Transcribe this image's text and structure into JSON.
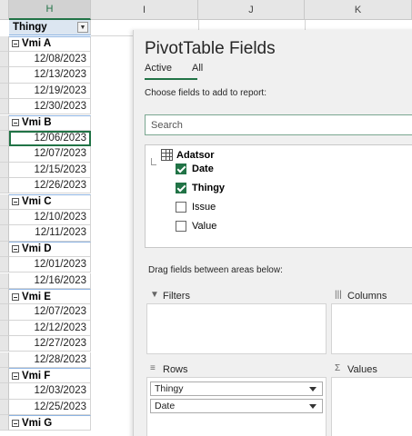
{
  "columns": [
    "H",
    "I",
    "J",
    "K"
  ],
  "selected_column": "H",
  "pivot_header": "Thingy",
  "filter_icon": "filter-dropdown-icon",
  "rows": [
    {
      "type": "group",
      "label": "Vmi A"
    },
    {
      "type": "date",
      "label": "12/08/2023"
    },
    {
      "type": "date",
      "label": "12/13/2023"
    },
    {
      "type": "date",
      "label": "12/19/2023"
    },
    {
      "type": "date",
      "label": "12/30/2023"
    },
    {
      "type": "group",
      "label": "Vmi B"
    },
    {
      "type": "date",
      "label": "12/06/2023",
      "selected": true
    },
    {
      "type": "date",
      "label": "12/07/2023"
    },
    {
      "type": "date",
      "label": "12/15/2023"
    },
    {
      "type": "date",
      "label": "12/26/2023"
    },
    {
      "type": "group",
      "label": "Vmi C"
    },
    {
      "type": "date",
      "label": "12/10/2023"
    },
    {
      "type": "date",
      "label": "12/11/2023"
    },
    {
      "type": "group",
      "label": "Vmi D"
    },
    {
      "type": "date",
      "label": "12/01/2023"
    },
    {
      "type": "date",
      "label": "12/16/2023"
    },
    {
      "type": "group",
      "label": "Vmi E"
    },
    {
      "type": "date",
      "label": "12/07/2023"
    },
    {
      "type": "date",
      "label": "12/12/2023"
    },
    {
      "type": "date",
      "label": "12/27/2023"
    },
    {
      "type": "date",
      "label": "12/28/2023"
    },
    {
      "type": "group",
      "label": "Vmi F"
    },
    {
      "type": "date",
      "label": "12/03/2023"
    },
    {
      "type": "date",
      "label": "12/25/2023"
    },
    {
      "type": "group",
      "label": "Vmi G"
    }
  ],
  "pane": {
    "title": "PivotTable Fields",
    "tabs": {
      "active": "Active",
      "all": "All"
    },
    "choose_text": "Choose fields to add to report:",
    "search_placeholder": "Search",
    "table_name": "Adatsor",
    "fields": [
      {
        "name": "Date",
        "checked": true
      },
      {
        "name": "Thingy",
        "checked": true
      },
      {
        "name": "Issue",
        "checked": false
      },
      {
        "name": "Value",
        "checked": false
      }
    ],
    "drag_text": "Drag fields between areas below:",
    "areas": {
      "filters": "Filters",
      "columns": "Columns",
      "rows": "Rows",
      "values": "Values"
    },
    "row_fields": [
      "Thingy",
      "Date"
    ]
  },
  "colors": {
    "accent": "#217346",
    "header_fill": "#dce6f1"
  }
}
